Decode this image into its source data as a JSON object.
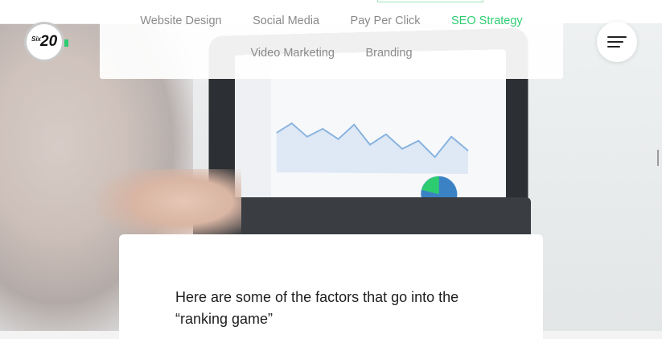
{
  "logo": {
    "prefix": "Six",
    "number": "20"
  },
  "nav": {
    "row1": [
      {
        "label": "Website Design",
        "active": false
      },
      {
        "label": "Social Media",
        "active": false
      },
      {
        "label": "Pay Per Click",
        "active": false
      },
      {
        "label": "SEO Strategy",
        "active": true
      }
    ],
    "row2": [
      {
        "label": "Video Marketing",
        "active": false
      },
      {
        "label": "Branding",
        "active": false
      }
    ]
  },
  "menu": {
    "icon": "hamburger-menu-icon"
  },
  "content": {
    "intro_line1": "Here are some of the factors that go into the",
    "intro_line2": "“ranking game”"
  },
  "colors": {
    "accent": "#2ecc71",
    "nav_text": "#8a8a8a",
    "body_text": "#1e1e1e"
  }
}
